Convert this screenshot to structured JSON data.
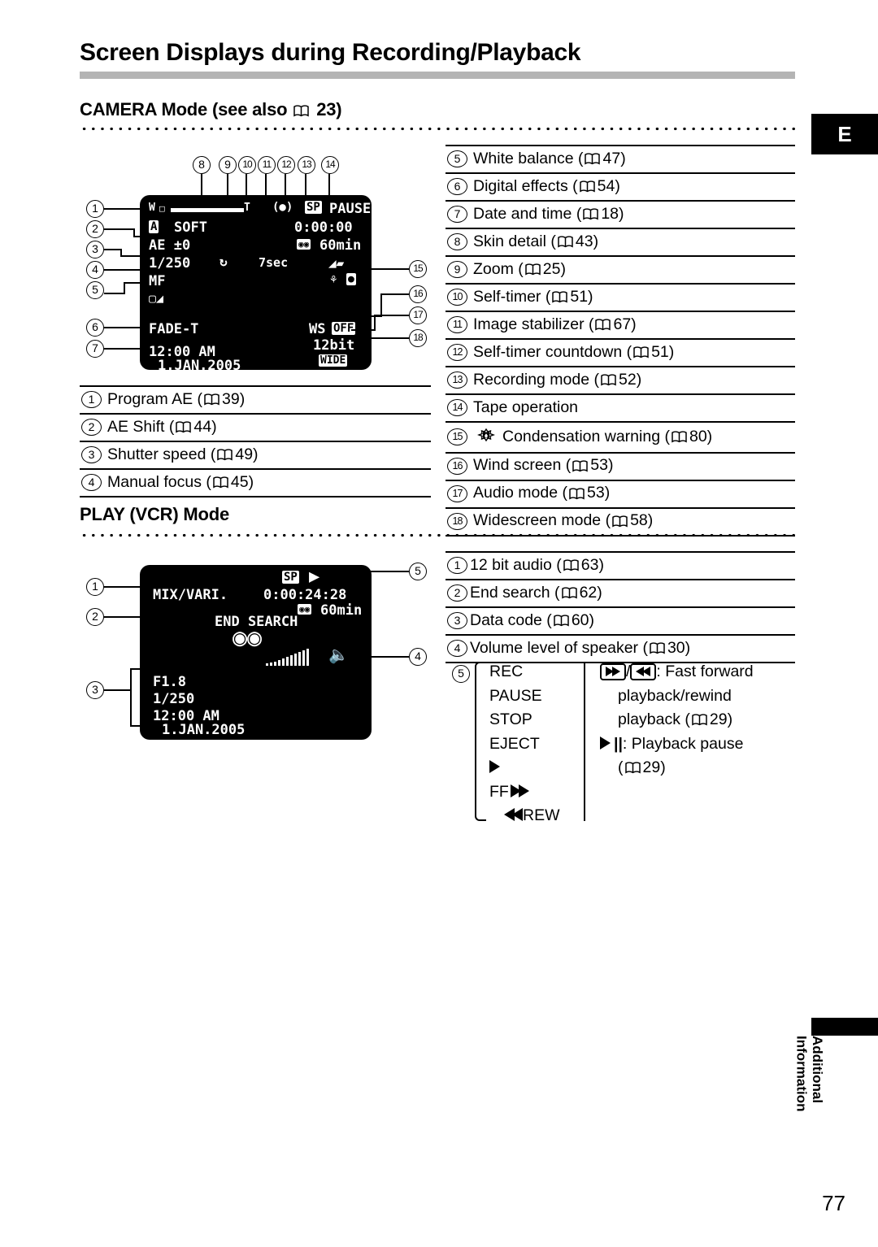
{
  "page": {
    "title": "Screen Displays during Recording/Playback",
    "number": "77",
    "lang_tab": "E",
    "side_tab": {
      "line1": "Additional",
      "line2": "Information"
    }
  },
  "sections": {
    "camera": {
      "heading": "CAMERA Mode (see also   23)",
      "heading_text": "CAMERA Mode (see also",
      "heading_ref": "23"
    },
    "play": {
      "heading": "PLAY (VCR) Mode"
    }
  },
  "camera_lcd": {
    "zoom_w": "W",
    "zoom_t": "T",
    "program_ae": "A",
    "digital_effect": "SOFT",
    "ae_shift": "AE ±0",
    "shutter_speed": "1/250",
    "focus": "MF",
    "self_timer_icon": "self-timer",
    "self_timer_countdown": "7sec",
    "image_stabilizer_icon": "image-stabilizer",
    "rec_mode": "SP",
    "tape_operation": "PAUSE",
    "timecode": "0:00:00",
    "tape_remaining": "60min",
    "fade": "FADE-T",
    "wind_screen_label": "WS",
    "wind_screen_value": "OFF",
    "audio_mode": "12bit",
    "widescreen": "WIDE",
    "time": "12:00 AM",
    "date": "1.JAN.2005"
  },
  "play_lcd": {
    "audio_mix": "MIX/VARI.",
    "rec_mode": "SP",
    "timecode": "0:00:24:28",
    "tape_remaining": "60min",
    "end_search": "END SEARCH",
    "aperture": "F1.8",
    "shutter_speed": "1/250",
    "time": "12:00 AM",
    "date": "1.JAN.2005"
  },
  "camera_callouts": {
    "left": [
      "1",
      "2",
      "3",
      "4",
      "5",
      "6",
      "7"
    ],
    "top": [
      "8",
      "9",
      "10",
      "11",
      "12",
      "13",
      "14"
    ],
    "right": [
      "15",
      "16",
      "17",
      "18"
    ]
  },
  "play_callouts": {
    "left": [
      "1",
      "2",
      "3"
    ],
    "right": [
      "5",
      "4"
    ]
  },
  "camera_legend_left": [
    {
      "n": "1",
      "label": "Program AE (",
      "page": "39",
      "tail": ")"
    },
    {
      "n": "2",
      "label": "AE Shift (",
      "page": "44",
      "tail": ")"
    },
    {
      "n": "3",
      "label": "Shutter speed ( ",
      "page": "49",
      "tail": ")"
    },
    {
      "n": "4",
      "label": "Manual focus (",
      "page": "45",
      "tail": ")"
    }
  ],
  "camera_legend_right": [
    {
      "n": "5",
      "label": "White balance (",
      "page": "47",
      "tail": ")"
    },
    {
      "n": "6",
      "label": "Digital effects (",
      "page": "54",
      "tail": ")"
    },
    {
      "n": "7",
      "label": "Date and time (",
      "page": "18",
      "tail": ")"
    },
    {
      "n": "8",
      "label": "Skin detail (",
      "page": "43",
      "tail": ")"
    },
    {
      "n": "9",
      "label": "Zoom (",
      "page": "25",
      "tail": ")"
    },
    {
      "n": "10",
      "label": "Self-timer (",
      "page": "51",
      "tail": ")"
    },
    {
      "n": "11",
      "label": "Image stabilizer (",
      "page": "67",
      "tail": ")"
    },
    {
      "n": "12",
      "label": "Self-timer countdown (",
      "page": "51",
      "tail": ")"
    },
    {
      "n": "13",
      "label": "Recording mode (",
      "page": "52",
      "tail": ")"
    },
    {
      "n": "14",
      "label": "Tape operation",
      "page": "",
      "tail": ""
    },
    {
      "n": "15",
      "label": "Condensation warning (",
      "page": "80",
      "tail": ")",
      "icon": "condensation-warning-icon"
    },
    {
      "n": "16",
      "label": "Wind screen (",
      "page": "53",
      "tail": ")"
    },
    {
      "n": "17",
      "label": "Audio mode (",
      "page": "53",
      "tail": ")"
    },
    {
      "n": "18",
      "label": "Widescreen mode (",
      "page": "58",
      "tail": ")"
    }
  ],
  "play_legend": [
    {
      "n": "1",
      "label": "12 bit audio (",
      "page": "63",
      "tail": ")"
    },
    {
      "n": "2",
      "label": "End search (",
      "page": "62",
      "tail": ")"
    },
    {
      "n": "3",
      "label": "Data code (",
      "page": "60",
      "tail": ")"
    },
    {
      "n": "4",
      "label": "Volume level of speaker (",
      "page": "30",
      "tail": ")"
    }
  ],
  "play_ops": {
    "number": "5",
    "left_items": [
      "REC",
      "PAUSE",
      "STOP",
      "EJECT",
      "▶",
      "FF",
      "REW"
    ],
    "right_lines": {
      "l1_sep": "/",
      "l1_text": ": Fast forward",
      "l2": "playback/rewind",
      "l3a": "playback (",
      "l3b": "29",
      "l3c": ")",
      "l4_bars": "||",
      "l4": ": Playback pause",
      "l5a": "(",
      "l5b": "29",
      "l5c": ")"
    }
  }
}
